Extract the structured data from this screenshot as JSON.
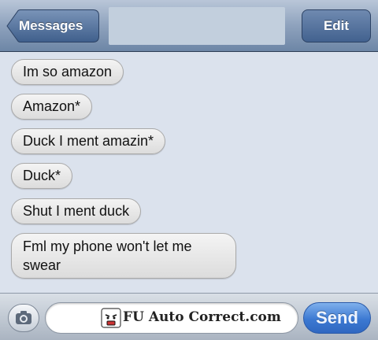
{
  "navbar": {
    "back_label": "Messages",
    "edit_label": "Edit"
  },
  "messages": [
    {
      "text": "Im so amazon"
    },
    {
      "text": "Amazon*"
    },
    {
      "text": "Duck I ment amazin*"
    },
    {
      "text": "Duck*"
    },
    {
      "text": "Shut I ment duck"
    },
    {
      "text": "Fml my phone won't let me swear"
    }
  ],
  "input_bar": {
    "watermark": "FU Auto Correct.com",
    "send_label": "Send"
  },
  "icons": {
    "camera": "camera-icon",
    "back": "chevron-left-icon",
    "watermark": "rage-face-icon"
  },
  "colors": {
    "thread_background": "#dbe2ed",
    "bubble": "#e8e8e8",
    "nav_button": "#42628f",
    "send_button": "#3c79d2"
  }
}
